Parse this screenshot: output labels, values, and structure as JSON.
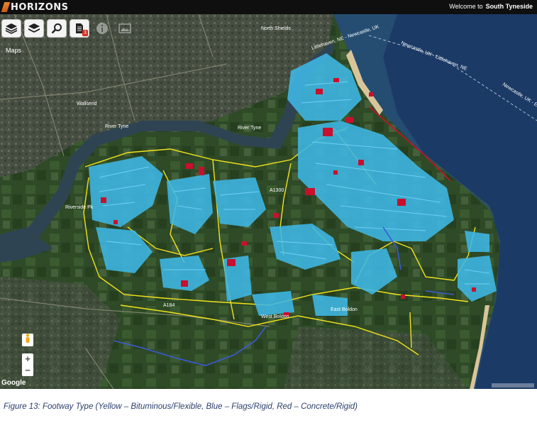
{
  "app": {
    "brand": "HORIZONS",
    "welcome_prefix": "Welcome to",
    "welcome_place": "South Tyneside"
  },
  "toolbar": {
    "buttons": [
      {
        "name": "layers-icon"
      },
      {
        "name": "layers-stack-icon"
      },
      {
        "name": "search-icon"
      },
      {
        "name": "document-icon",
        "badge": "3"
      },
      {
        "name": "info-icon"
      },
      {
        "name": "image-icon"
      }
    ]
  },
  "map": {
    "maps_label": "Maps",
    "labels": {
      "north_shields": "North Shields",
      "river_tyne": "River Tyne",
      "river_tyne_2": "River Tyne",
      "wallsend": "Wallsend",
      "riverside": "Riverside Pk",
      "west_boldon": "West Boldon",
      "east_boldon": "East Boldon",
      "a184": "A184",
      "a1300": "A1300",
      "littlehaven": "Littlehaven, NE - Newcastle, UK",
      "newcastle_ne": "Newcastle, UK - Littlehaven, NE",
      "newcastle_uk": "Newcastle, UK - East"
    },
    "legend_colors": {
      "bituminous": "#f2e21a",
      "flags": "#3fb8e6",
      "concrete": "#c8102e",
      "other": "#3a5bd8"
    },
    "google": "Google",
    "zoom_in": "+",
    "zoom_out": "−"
  },
  "caption": "Figure 13: Footway Type (Yellow – Bituminous/Flexible, Blue – Flags/Rigid, Red – Concrete/Rigid)"
}
